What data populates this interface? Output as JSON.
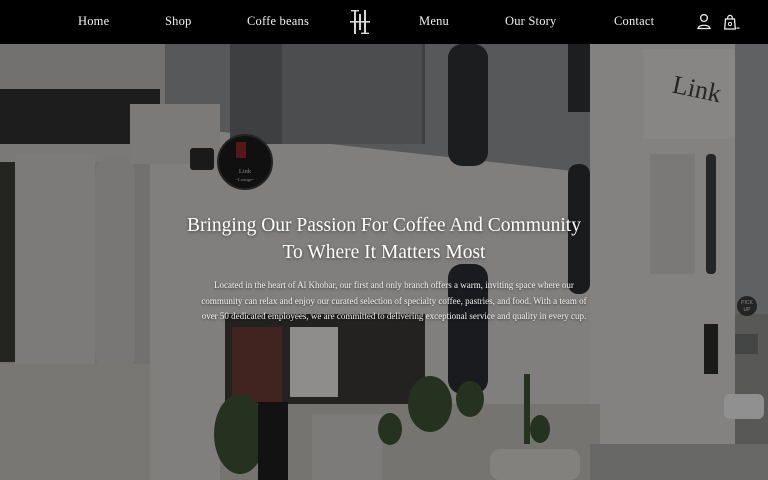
{
  "nav": {
    "items": [
      {
        "label": "Home"
      },
      {
        "label": "Shop"
      },
      {
        "label": "Coffe beans"
      },
      {
        "label": "Menu"
      },
      {
        "label": "Our Story"
      },
      {
        "label": "Contact"
      }
    ],
    "icons": [
      "account-icon",
      "shopping-bag-icon"
    ]
  },
  "hero": {
    "heading": "Bringing Our Passion For Coffee And Community To Where It Matters Most",
    "description": "Located in the heart of Al Khobar, our first and only branch offers a warm, inviting space where our community can relax and enjoy our curated selection of specialty coffee, pastries, and food. With a team of over 50 dedicated employees, we are committed to delivering exceptional service and quality in every cup.",
    "storefront_sign": "Link Lounge",
    "wall_sign": "Link",
    "pickup_sign": "PICK UP"
  },
  "colors": {
    "navbar_bg": "#000000",
    "accent_red": "#9b2a2a",
    "text": "#ffffff"
  }
}
